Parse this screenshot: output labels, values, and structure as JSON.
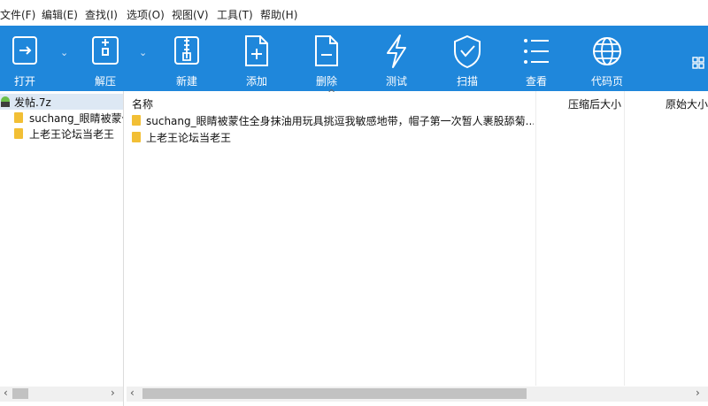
{
  "menu": [
    "文件(F)",
    "编辑(E)",
    "查找(I)",
    "选项(O)",
    "视图(V)",
    "工具(T)",
    "帮助(H)"
  ],
  "toolbar": {
    "buttons": [
      {
        "label": "打开",
        "icon": "open-icon"
      },
      {
        "label": "解压",
        "icon": "extract-icon"
      },
      {
        "label": "新建",
        "icon": "new-archive-icon"
      },
      {
        "label": "添加",
        "icon": "add-icon"
      },
      {
        "label": "删除",
        "icon": "delete-icon"
      },
      {
        "label": "测试",
        "icon": "test-icon"
      },
      {
        "label": "扫描",
        "icon": "scan-icon"
      },
      {
        "label": "查看",
        "icon": "view-icon"
      },
      {
        "label": "代码页",
        "icon": "codepage-icon"
      }
    ],
    "dropdown_glyph": "⌄",
    "background": "#1f87db"
  },
  "tree": {
    "root": "发帖.7z",
    "children": [
      "suchang_眼睛被蒙住全身抹油用玩具挑逗我敏感地带，帽子第一次暂人裹股舔菊...",
      "上老王论坛当老王"
    ]
  },
  "columns": {
    "name": "名称",
    "compressed": "压缩后大小",
    "original": "原始大小",
    "sort_glyph": "^"
  },
  "files": [
    {
      "name": "suchang_眼睛被蒙住全身抹油用玩具挑逗我敏感地带，帽子第一次暂人裹股舔菊..."
    },
    {
      "name": "上老王论坛当老王"
    }
  ],
  "scroll": {
    "left": "‹",
    "right": "›"
  }
}
